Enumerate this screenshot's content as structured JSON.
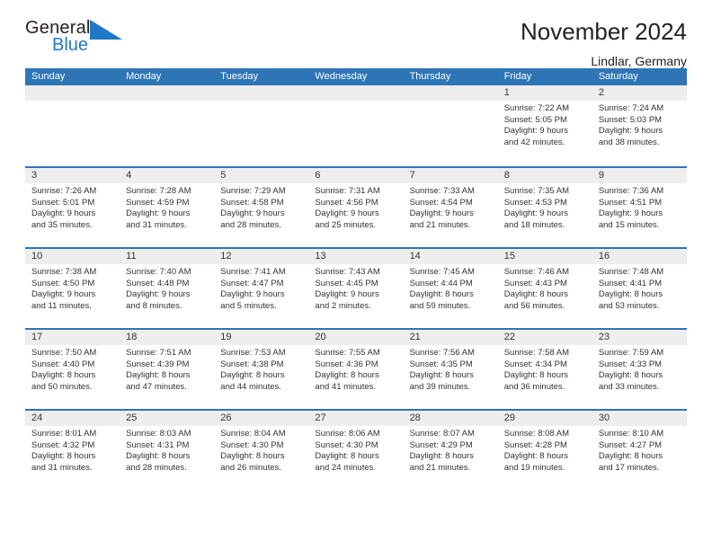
{
  "brand": {
    "name_dark": "General",
    "name_blue": "Blue",
    "triangle_color": "#2079c7"
  },
  "header": {
    "title": "November 2024",
    "subtitle": "Lindlar, Germany",
    "accent": "#2e75b6"
  },
  "weekdays": [
    "Sunday",
    "Monday",
    "Tuesday",
    "Wednesday",
    "Thursday",
    "Friday",
    "Saturday"
  ],
  "weeks": [
    [
      {
        "day": "",
        "lines": []
      },
      {
        "day": "",
        "lines": []
      },
      {
        "day": "",
        "lines": []
      },
      {
        "day": "",
        "lines": []
      },
      {
        "day": "",
        "lines": []
      },
      {
        "day": "1",
        "lines": [
          "Sunrise: 7:22 AM",
          "Sunset: 5:05 PM",
          "Daylight: 9 hours",
          "and 42 minutes."
        ]
      },
      {
        "day": "2",
        "lines": [
          "Sunrise: 7:24 AM",
          "Sunset: 5:03 PM",
          "Daylight: 9 hours",
          "and 38 minutes."
        ]
      }
    ],
    [
      {
        "day": "3",
        "lines": [
          "Sunrise: 7:26 AM",
          "Sunset: 5:01 PM",
          "Daylight: 9 hours",
          "and 35 minutes."
        ]
      },
      {
        "day": "4",
        "lines": [
          "Sunrise: 7:28 AM",
          "Sunset: 4:59 PM",
          "Daylight: 9 hours",
          "and 31 minutes."
        ]
      },
      {
        "day": "5",
        "lines": [
          "Sunrise: 7:29 AM",
          "Sunset: 4:58 PM",
          "Daylight: 9 hours",
          "and 28 minutes."
        ]
      },
      {
        "day": "6",
        "lines": [
          "Sunrise: 7:31 AM",
          "Sunset: 4:56 PM",
          "Daylight: 9 hours",
          "and 25 minutes."
        ]
      },
      {
        "day": "7",
        "lines": [
          "Sunrise: 7:33 AM",
          "Sunset: 4:54 PM",
          "Daylight: 9 hours",
          "and 21 minutes."
        ]
      },
      {
        "day": "8",
        "lines": [
          "Sunrise: 7:35 AM",
          "Sunset: 4:53 PM",
          "Daylight: 9 hours",
          "and 18 minutes."
        ]
      },
      {
        "day": "9",
        "lines": [
          "Sunrise: 7:36 AM",
          "Sunset: 4:51 PM",
          "Daylight: 9 hours",
          "and 15 minutes."
        ]
      }
    ],
    [
      {
        "day": "10",
        "lines": [
          "Sunrise: 7:38 AM",
          "Sunset: 4:50 PM",
          "Daylight: 9 hours",
          "and 11 minutes."
        ]
      },
      {
        "day": "11",
        "lines": [
          "Sunrise: 7:40 AM",
          "Sunset: 4:48 PM",
          "Daylight: 9 hours",
          "and 8 minutes."
        ]
      },
      {
        "day": "12",
        "lines": [
          "Sunrise: 7:41 AM",
          "Sunset: 4:47 PM",
          "Daylight: 9 hours",
          "and 5 minutes."
        ]
      },
      {
        "day": "13",
        "lines": [
          "Sunrise: 7:43 AM",
          "Sunset: 4:45 PM",
          "Daylight: 9 hours",
          "and 2 minutes."
        ]
      },
      {
        "day": "14",
        "lines": [
          "Sunrise: 7:45 AM",
          "Sunset: 4:44 PM",
          "Daylight: 8 hours",
          "and 59 minutes."
        ]
      },
      {
        "day": "15",
        "lines": [
          "Sunrise: 7:46 AM",
          "Sunset: 4:43 PM",
          "Daylight: 8 hours",
          "and 56 minutes."
        ]
      },
      {
        "day": "16",
        "lines": [
          "Sunrise: 7:48 AM",
          "Sunset: 4:41 PM",
          "Daylight: 8 hours",
          "and 53 minutes."
        ]
      }
    ],
    [
      {
        "day": "17",
        "lines": [
          "Sunrise: 7:50 AM",
          "Sunset: 4:40 PM",
          "Daylight: 8 hours",
          "and 50 minutes."
        ]
      },
      {
        "day": "18",
        "lines": [
          "Sunrise: 7:51 AM",
          "Sunset: 4:39 PM",
          "Daylight: 8 hours",
          "and 47 minutes."
        ]
      },
      {
        "day": "19",
        "lines": [
          "Sunrise: 7:53 AM",
          "Sunset: 4:38 PM",
          "Daylight: 8 hours",
          "and 44 minutes."
        ]
      },
      {
        "day": "20",
        "lines": [
          "Sunrise: 7:55 AM",
          "Sunset: 4:36 PM",
          "Daylight: 8 hours",
          "and 41 minutes."
        ]
      },
      {
        "day": "21",
        "lines": [
          "Sunrise: 7:56 AM",
          "Sunset: 4:35 PM",
          "Daylight: 8 hours",
          "and 39 minutes."
        ]
      },
      {
        "day": "22",
        "lines": [
          "Sunrise: 7:58 AM",
          "Sunset: 4:34 PM",
          "Daylight: 8 hours",
          "and 36 minutes."
        ]
      },
      {
        "day": "23",
        "lines": [
          "Sunrise: 7:59 AM",
          "Sunset: 4:33 PM",
          "Daylight: 8 hours",
          "and 33 minutes."
        ]
      }
    ],
    [
      {
        "day": "24",
        "lines": [
          "Sunrise: 8:01 AM",
          "Sunset: 4:32 PM",
          "Daylight: 8 hours",
          "and 31 minutes."
        ]
      },
      {
        "day": "25",
        "lines": [
          "Sunrise: 8:03 AM",
          "Sunset: 4:31 PM",
          "Daylight: 8 hours",
          "and 28 minutes."
        ]
      },
      {
        "day": "26",
        "lines": [
          "Sunrise: 8:04 AM",
          "Sunset: 4:30 PM",
          "Daylight: 8 hours",
          "and 26 minutes."
        ]
      },
      {
        "day": "27",
        "lines": [
          "Sunrise: 8:06 AM",
          "Sunset: 4:30 PM",
          "Daylight: 8 hours",
          "and 24 minutes."
        ]
      },
      {
        "day": "28",
        "lines": [
          "Sunrise: 8:07 AM",
          "Sunset: 4:29 PM",
          "Daylight: 8 hours",
          "and 21 minutes."
        ]
      },
      {
        "day": "29",
        "lines": [
          "Sunrise: 8:08 AM",
          "Sunset: 4:28 PM",
          "Daylight: 8 hours",
          "and 19 minutes."
        ]
      },
      {
        "day": "30",
        "lines": [
          "Sunrise: 8:10 AM",
          "Sunset: 4:27 PM",
          "Daylight: 8 hours",
          "and 17 minutes."
        ]
      }
    ]
  ]
}
